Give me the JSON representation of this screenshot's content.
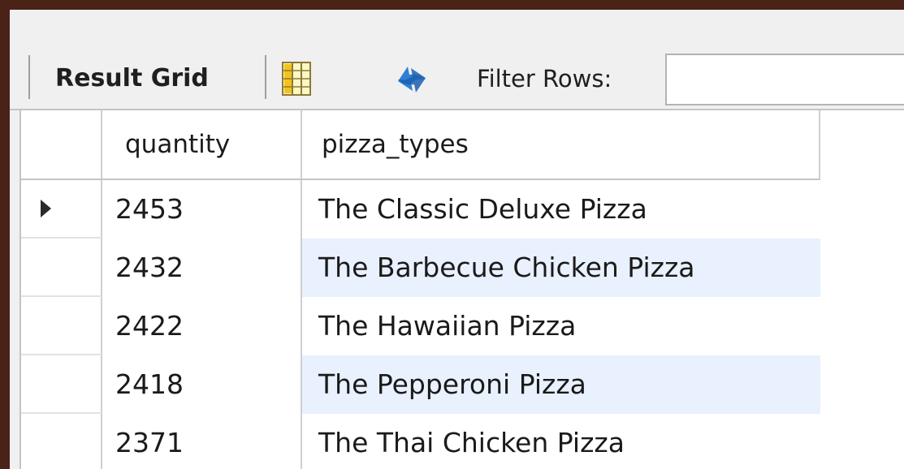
{
  "toolbar": {
    "result_grid_label": "Result Grid",
    "filter_rows_label": "Filter Rows:",
    "filter_value": ""
  },
  "grid": {
    "columns": [
      "quantity",
      "pizza_types"
    ],
    "rows": [
      {
        "quantity": "2453",
        "pizza_types": "The Classic Deluxe Pizza"
      },
      {
        "quantity": "2432",
        "pizza_types": "The Barbecue Chicken Pizza"
      },
      {
        "quantity": "2422",
        "pizza_types": "The Hawaiian Pizza"
      },
      {
        "quantity": "2418",
        "pizza_types": "The Pepperoni Pizza"
      },
      {
        "quantity": "2371",
        "pizza_types": "The Thai Chicken Pizza"
      }
    ],
    "selected_row": 0
  },
  "colors": {
    "frame_border": "#4a2217",
    "alt_row": "#e8f1fd",
    "refresh_blue": "#2f7fd6"
  },
  "icons": {
    "grid_toggle": "form-grid-icon",
    "refresh": "refresh-icon",
    "row_pointer": "row-pointer-icon"
  }
}
